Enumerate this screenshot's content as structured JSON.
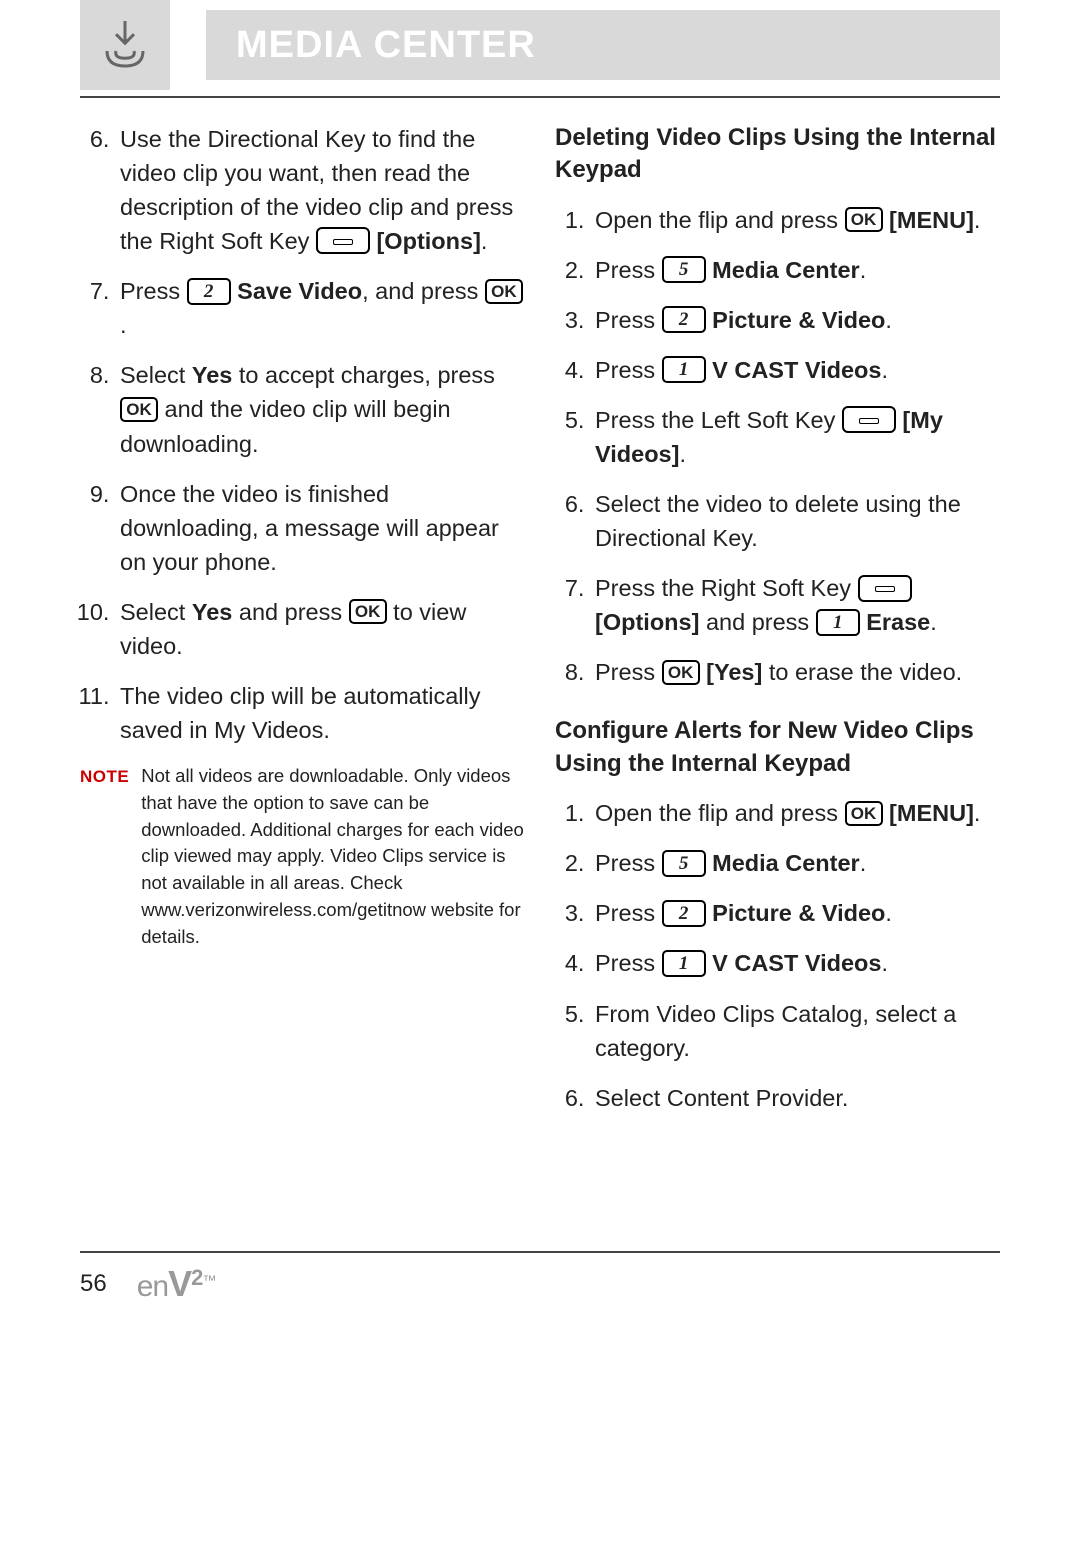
{
  "header": {
    "title": "MEDIA CENTER"
  },
  "left_column": {
    "steps": [
      {
        "n": "6",
        "p1": "Use the Directional Key to find the video clip you want, then read the description of the video clip and press the Right Soft Key ",
        "key1": "soft",
        "p2": "",
        "bold_after": "[Options]",
        "tail": "."
      },
      {
        "n": "7",
        "p1": "Press ",
        "key1": "2",
        "p2": " ",
        "bold_after": "Save Video",
        "tail": ", and press ",
        "key2": "OK",
        "tail2": "."
      },
      {
        "n": "8",
        "p1": "Select ",
        "bold1": "Yes",
        "p2": " to accept charges, press ",
        "key1": "OK",
        "p3": " and the video clip will begin downloading."
      },
      {
        "n": "9",
        "p1": "Once the video is finished downloading, a message will appear on your phone."
      },
      {
        "n": "10",
        "p1": "Select ",
        "bold1": "Yes",
        "p2": " and press ",
        "key1": "OK",
        "p3": " to view video."
      },
      {
        "n": "11",
        "p1": "The video clip will be automatically saved in My Videos."
      }
    ],
    "note_label": "NOTE",
    "note_text": "Not all videos are downloadable. Only videos that have the option to save can be downloaded. Additional charges for each video clip viewed may apply. Video Clips service is not available in all areas. Check www.verizonwireless.com/getitnow website for details."
  },
  "right_column": {
    "section1_title": "Deleting Video Clips Using the Internal Keypad",
    "s1": [
      {
        "n": "1",
        "p1": "Open the flip and press ",
        "key1": "OK",
        "p2": " ",
        "bold_after": "[MENU]",
        "tail": "."
      },
      {
        "n": "2",
        "p1": "Press ",
        "key1": "5",
        "p2": " ",
        "bold_after": "Media Center",
        "tail": "."
      },
      {
        "n": "3",
        "p1": "Press ",
        "key1": "2",
        "p2": " ",
        "bold_after": "Picture & Video",
        "tail": "."
      },
      {
        "n": "4",
        "p1": "Press ",
        "key1": "1",
        "p2": " ",
        "bold_after": "V CAST Videos",
        "tail": "."
      },
      {
        "n": "5",
        "p1": "Press the Left Soft Key ",
        "key1": "soft",
        "p2": " ",
        "bold_after": "[My Videos]",
        "tail": "."
      },
      {
        "n": "6",
        "p1": "Select the video to delete using the Directional Key."
      },
      {
        "n": "7",
        "p1": "Press the Right Soft Key ",
        "key1": "soft",
        "p2": " ",
        "bold_after": "[Options]",
        "tail": " and press ",
        "key2": "1",
        "tail2": " ",
        "bold2": "Erase",
        "tail3": "."
      },
      {
        "n": "8",
        "p1": "Press ",
        "key1": "OK",
        "p2": " ",
        "bold_after": "[Yes]",
        "tail": " to erase the video."
      }
    ],
    "section2_title": "Configure Alerts for New Video Clips Using the Internal Keypad",
    "s2": [
      {
        "n": "1",
        "p1": "Open the flip and press ",
        "key1": "OK",
        "p2": " ",
        "bold_after": "[MENU]",
        "tail": "."
      },
      {
        "n": "2",
        "p1": "Press ",
        "key1": "5",
        "p2": " ",
        "bold_after": "Media Center",
        "tail": "."
      },
      {
        "n": "3",
        "p1": "Press ",
        "key1": "2",
        "p2": " ",
        "bold_after": "Picture & Video",
        "tail": "."
      },
      {
        "n": "4",
        "p1": "Press ",
        "key1": "1",
        "p2": " ",
        "bold_after": "V CAST Videos",
        "tail": "."
      },
      {
        "n": "5",
        "p1": "From Video Clips Catalog, select a category."
      },
      {
        "n": "6",
        "p1": "Select Content Provider."
      }
    ]
  },
  "footer": {
    "page": "56",
    "logo_en": "en",
    "logo_v": "V",
    "logo_two": "2",
    "logo_tm": "™"
  },
  "keys": {
    "ok": "OK",
    "1": "1",
    "2": "2",
    "5": "5"
  }
}
